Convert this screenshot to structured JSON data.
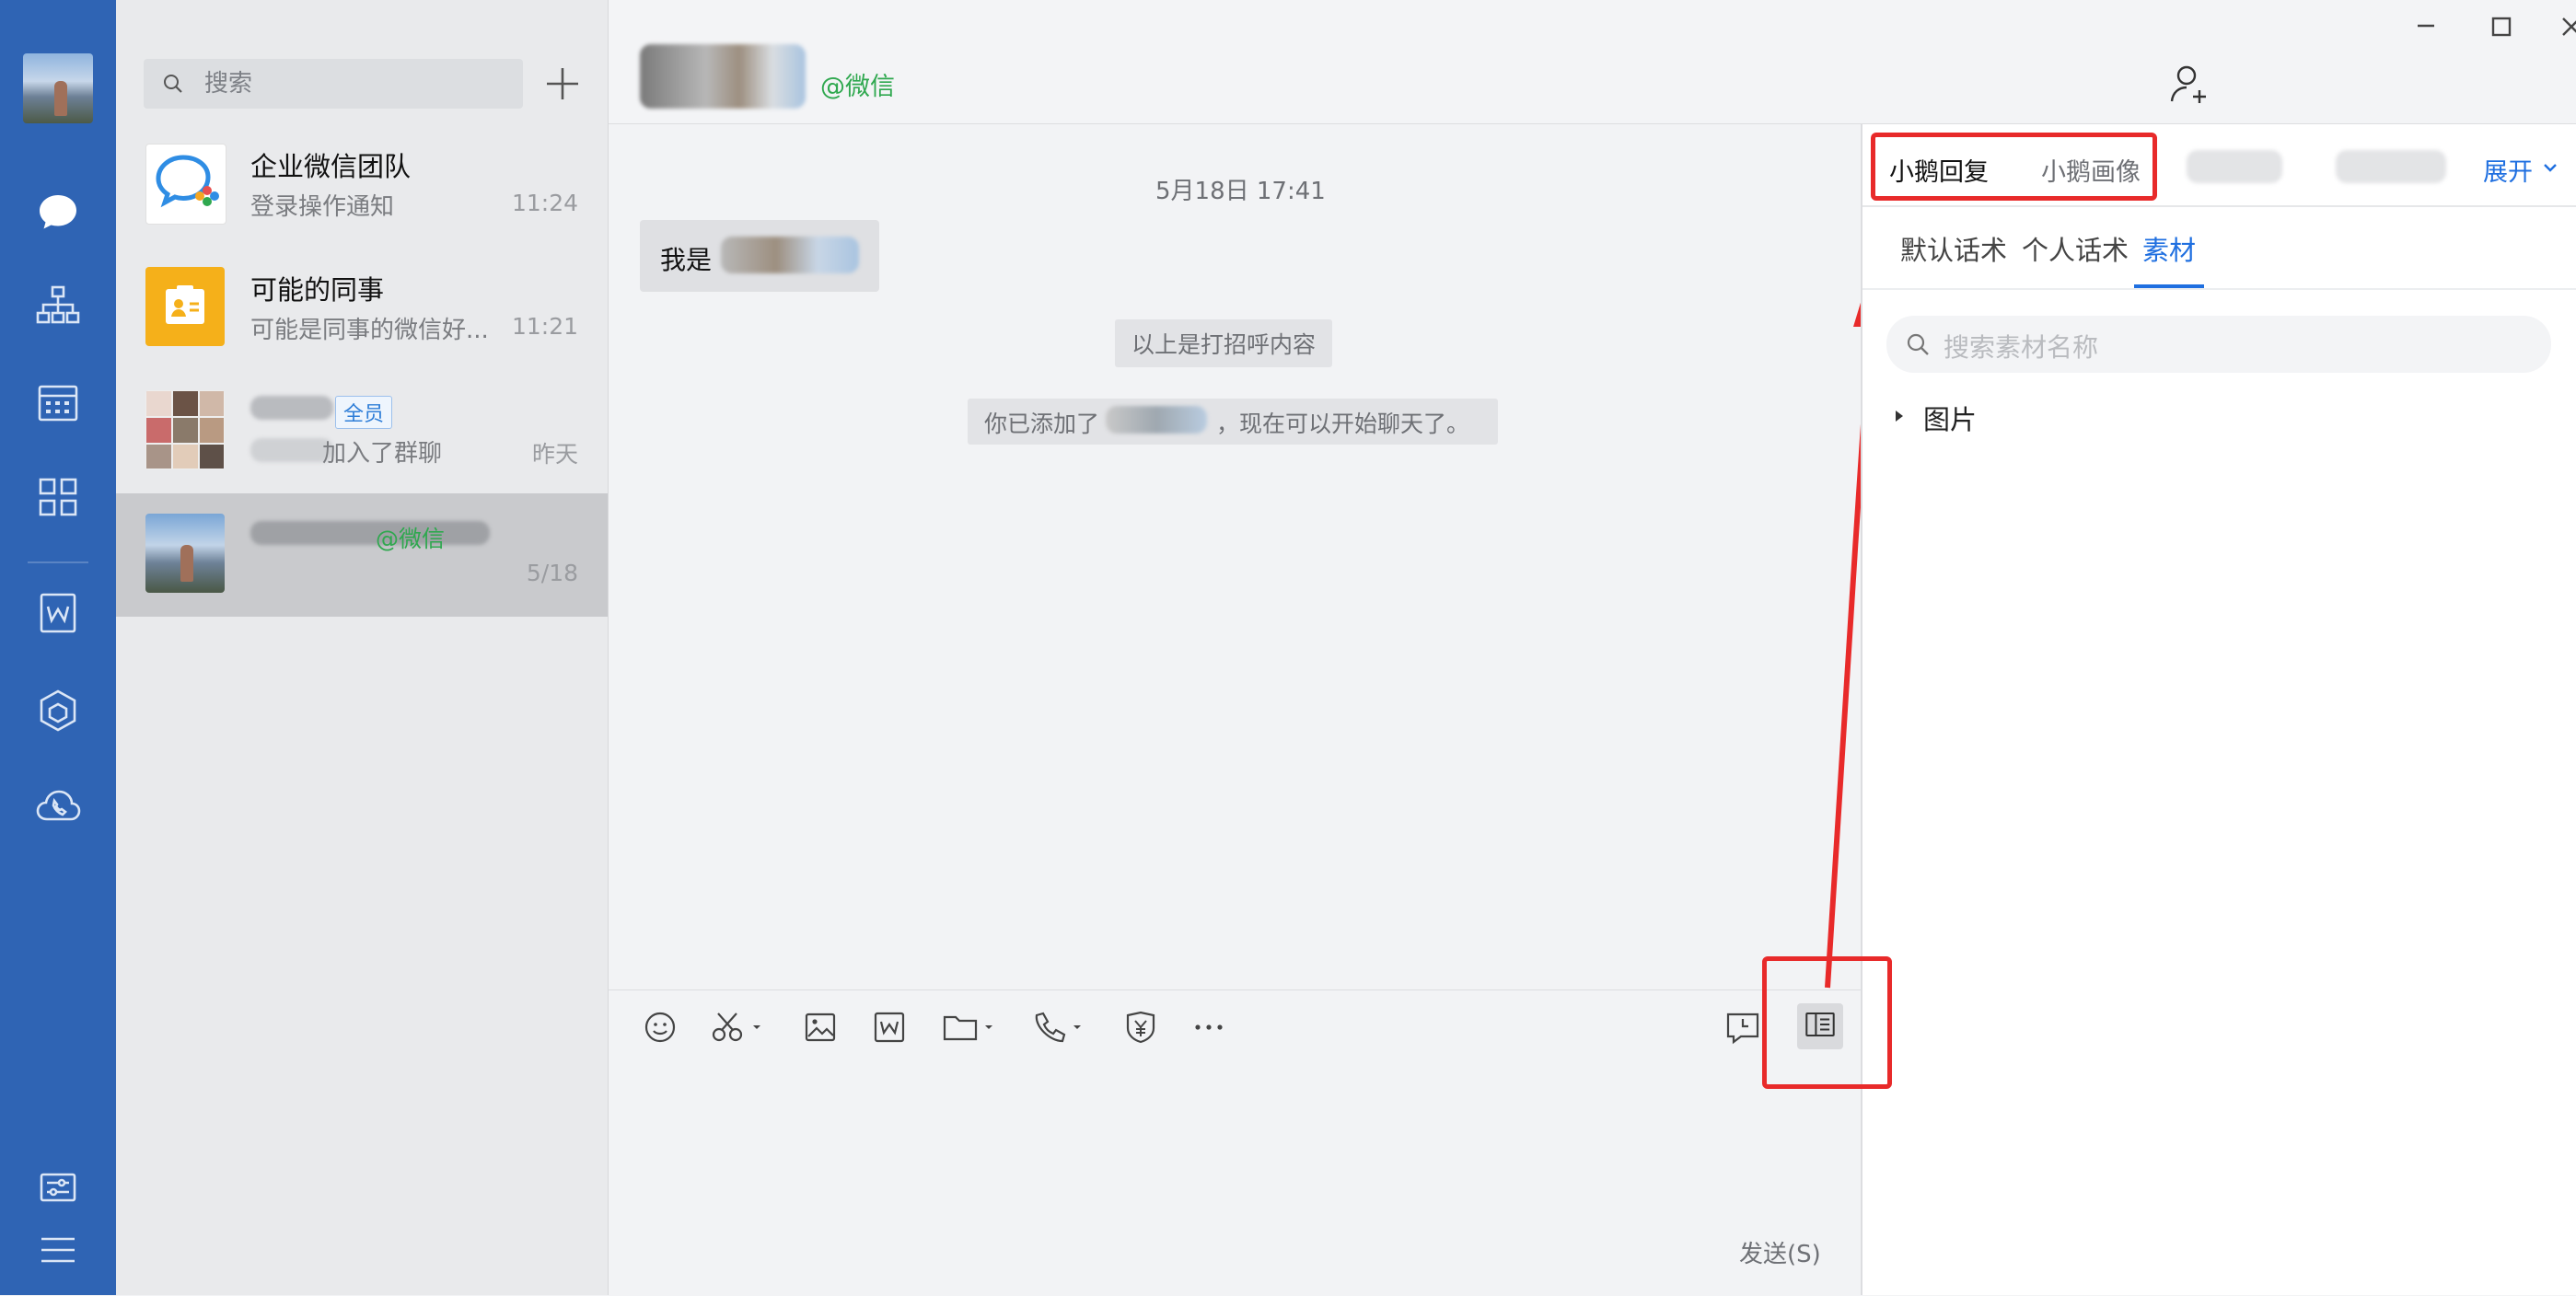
{
  "sidebar": {
    "icons": [
      "user-avatar",
      "chat-bubble-icon",
      "org-structure-icon",
      "calendar-icon",
      "apps-grid-icon",
      "document-w-icon",
      "workbench-icon",
      "cloud-phone-icon",
      "settings-sliders-icon",
      "menu-icon"
    ]
  },
  "search": {
    "placeholder": "搜索"
  },
  "conversations": [
    {
      "name": "企业微信团队",
      "preview": "登录操作通知",
      "time": "11:24"
    },
    {
      "name": "可能的同事",
      "preview": "可能是同事的微信好...",
      "time": "11:21"
    },
    {
      "badge": "全员",
      "preview": "加入了群聊",
      "time": "昨天"
    },
    {
      "suffix": "@微信",
      "time": "5/18"
    }
  ],
  "chat": {
    "header_suffix": "@微信",
    "date_divider": "5月18日 17:41",
    "message_prefix": "我是",
    "system_greeting": "以上是打招呼内容",
    "system_added_prefix": "你已添加了",
    "system_added_suffix": "，现在可以开始聊天了。",
    "send_label": "发送(S)"
  },
  "right_panel": {
    "tabs": [
      "小鹅回复",
      "小鹅画像"
    ],
    "expand_label": "展开",
    "subtabs": [
      "默认话术",
      "个人话术",
      "素材"
    ],
    "active_subtab": "素材",
    "search_placeholder": "搜索素材名称",
    "tree_items": [
      "图片"
    ]
  },
  "colors": {
    "rail": "#2f64b4",
    "accent": "#1f6fe0",
    "wechat_green": "#2fa84f",
    "annotation_red": "#e82a2a"
  }
}
